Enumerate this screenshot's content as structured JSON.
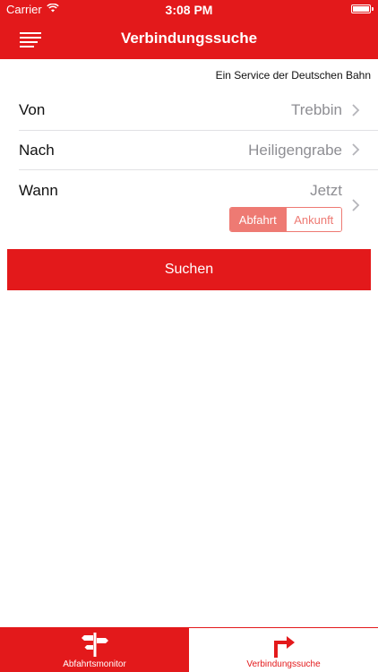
{
  "status_bar": {
    "carrier": "Carrier",
    "time": "3:08 PM"
  },
  "header": {
    "title": "Verbindungssuche",
    "menu_icon": "hamburger-menu-icon"
  },
  "service_note": "Ein Service der Deutschen Bahn",
  "form": {
    "from": {
      "label": "Von",
      "value": "Trebbin"
    },
    "to": {
      "label": "Nach",
      "value": "Heiligengrabe"
    },
    "when": {
      "label": "Wann",
      "value": "Jetzt"
    },
    "mode": {
      "options": [
        "Abfahrt",
        "Ankunft"
      ],
      "selected": "Abfahrt"
    }
  },
  "search_button": "Suchen",
  "tabs": [
    {
      "label": "Abfahrtsmonitor",
      "icon": "signpost-icon",
      "active": true
    },
    {
      "label": "Verbindungssuche",
      "icon": "turn-right-arrow-icon",
      "active": false
    }
  ],
  "colors": {
    "accent": "#e3191b",
    "segment": "#ee7a73",
    "value_gray": "#8e8e93"
  }
}
